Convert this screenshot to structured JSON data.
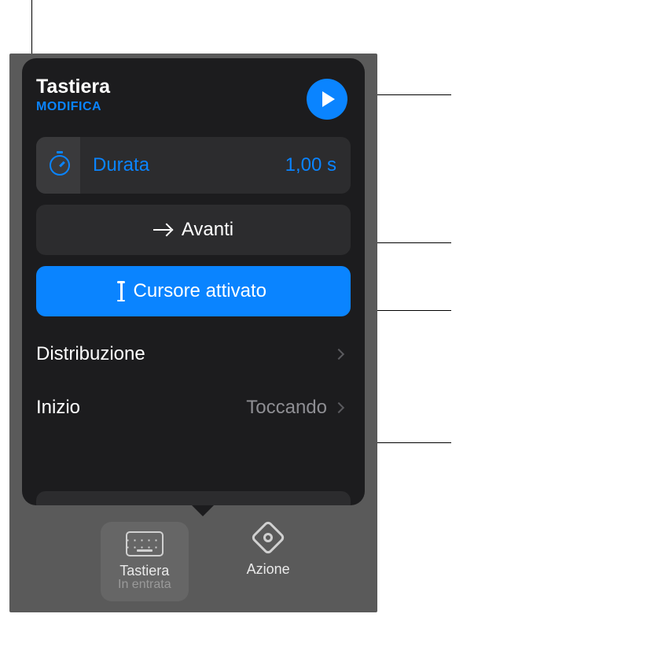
{
  "popover": {
    "title": "Tastiera",
    "edit_label": "MODIFICA",
    "duration": {
      "label": "Durata",
      "value": "1,00 s"
    },
    "forward_label": "Avanti",
    "cursor_label": "Cursore attivato",
    "rows": {
      "distribution": {
        "label": "Distribuzione"
      },
      "start": {
        "label": "Inizio",
        "value": "Toccando"
      }
    }
  },
  "dock": {
    "keyboard": {
      "label": "Tastiera",
      "sub": "In entrata"
    },
    "action": {
      "label": "Azione"
    }
  }
}
